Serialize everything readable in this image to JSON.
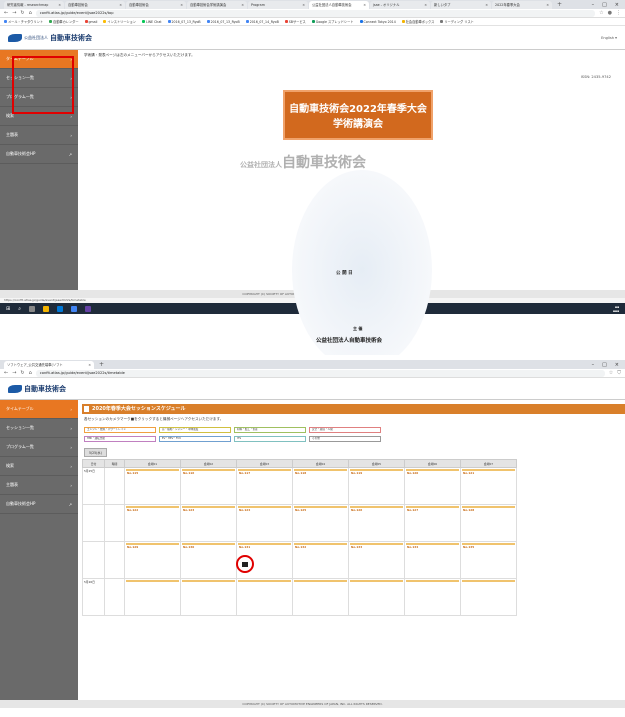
{
  "screen1": {
    "tabs": [
      "研究者情報 - researchmap",
      "自動車技術会",
      "自動車技術会",
      "自動車技術会学術講演会",
      "Program",
      "公益社団法人自動車技術会",
      "jsae - オリジナル",
      "新しいタブ",
      "2022年春季大会"
    ],
    "url": "confit.atlas.jp/guide/event/jsae2022s/top",
    "bookmarks": [
      "メール・チャタウリント",
      "自動車カレンダー",
      "gmail",
      "インストリーション",
      "LINE Chat",
      "2016_07_13_RyoB",
      "2016_07_13_RyoB",
      "2016_07_14_RyoB",
      "SBサービス",
      "Google スプレッドシート",
      "Connect Tokyo 2014",
      "社会自動車ボックス",
      "リーディング リスト"
    ],
    "logo_small": "公益社団法人",
    "logo_text": "自動車技術会",
    "lang": "English ▾",
    "sidebar": [
      "タイムテーブル",
      "セッション一覧",
      "プログラム一覧",
      "検索",
      "主題表",
      "自動車技術会HP"
    ],
    "note": "学術講・発表ページは左のメニューバーからアクセスいただけます。",
    "issn": "ISSN: 2435-9742",
    "title_line1": "自動車技術会2022年春季大会",
    "title_line2": "学術講演会",
    "corp_small": "公益社団法人",
    "corp_big": "自動車技術会",
    "pub_label": "公 開 日",
    "host_label": "主 催",
    "host": "公益社団法人自動車技術会",
    "copyright": "COPYRIGHT (C) SOCIETY OF AUTOMOTIVE ENGINEERS OF JAPAN, INC. ALL RIGHTS RESERVED.",
    "status_url": "https://confit.atlas.jp/guide/event/jsae2022s/timetable"
  },
  "screen2": {
    "tabs": [
      "ソフトウェア_公共交通先端車(ソフト",
      "+"
    ],
    "url": "confit.atlas.jp/guide/event/jsae2022s/timetable",
    "logo_text": "自動車技術会",
    "sidebar": [
      "タイムテーブル",
      "セッション一覧",
      "プログラム一覧",
      "検索",
      "主題表",
      "自動車技術会HP"
    ],
    "sched_title": "2020年春季大会セッションスケジュール",
    "sched_note": "各セッションのカメラマーク■をクリックすると機械ページへアクセスいただけます。",
    "legend": [
      "エンジン・燃焼・パワートレイン",
      "音・振動・シャシー・車体強度",
      "材料・加工・生産",
      "安全・環境・人間",
      "HMI・運転支援",
      "EV・HEV・FCV",
      "ITS",
      "その他"
    ],
    "dates_label": "5/25(水)",
    "columns": [
      "日付",
      "時間",
      "会場01",
      "会場02",
      "会場03",
      "会場04",
      "会場05",
      "会場06",
      "会場07"
    ],
    "date_rows": [
      "5月25日",
      "5月26日"
    ],
    "sessions": [
      "No.115",
      "No.116",
      "No.117",
      "No.118",
      "No.119",
      "No.120",
      "No.121",
      "No.122",
      "No.123",
      "No.124",
      "No.125",
      "No.126",
      "No.127",
      "No.128",
      "No.129",
      "No.130",
      "No.131",
      "No.132",
      "No.133",
      "No.134",
      "No.135"
    ],
    "copyright": "COPYRIGHT (C) SOCIETY OF AUTOMOTIVE ENGINEERS OF JAPAN, INC. ALL RIGHTS RESERVED."
  }
}
